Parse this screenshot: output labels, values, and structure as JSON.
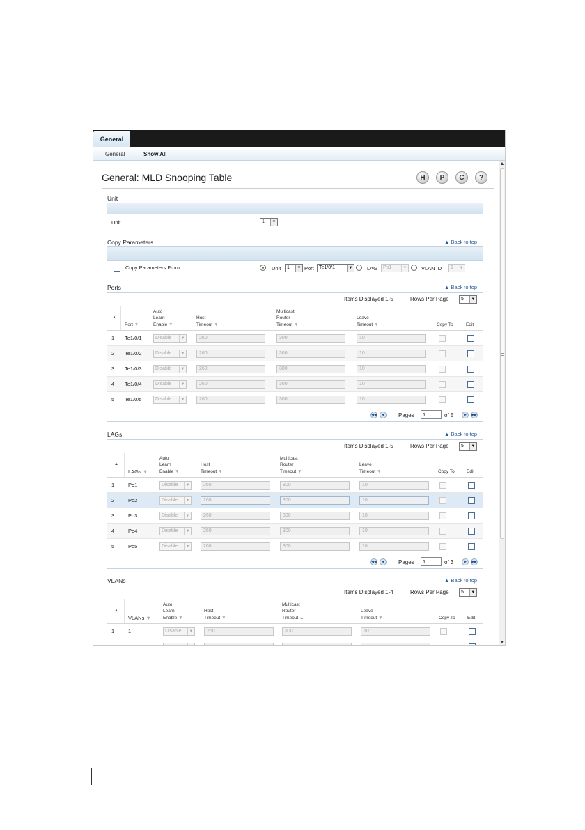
{
  "top_tab": "General",
  "subnav": {
    "general": "General",
    "show_all": "Show All"
  },
  "title": "General: MLD Snooping Table",
  "toolbar": {
    "save": "H",
    "print": "P",
    "refresh": "C",
    "help": "?"
  },
  "back_to_top": "Back to top",
  "unit_section": {
    "title": "Unit",
    "label": "Unit",
    "value": "1"
  },
  "copy_section": {
    "title": "Copy Parameters",
    "checkbox_label": "Copy Parameters From",
    "unit_label": "Unit",
    "unit_value": "1",
    "port_label": "Port",
    "port_value": "Te1/0/1",
    "lag_label": "LAG",
    "lag_value": "Po1",
    "vlan_label": "VLAN ID",
    "vlan_value": "1"
  },
  "common": {
    "rows_per_page_label": "Rows Per Page",
    "rows_per_page_value": "5",
    "pages_label": "Pages",
    "disable": "Disable",
    "h_auto": [
      "Auto",
      "Learn",
      "Enable"
    ],
    "h_host": [
      "Host",
      "Timeout"
    ],
    "h_mrouter": [
      "Multicast",
      "Router",
      "Timeout"
    ],
    "h_leave": [
      "Leave",
      "Timeout"
    ],
    "h_copy": "Copy To",
    "h_edit": "Edit"
  },
  "ports": {
    "title": "Ports",
    "items_displayed": "Items Displayed 1-5",
    "col_name": "Port",
    "rows": [
      {
        "idx": "1",
        "name": "Te1/0/1",
        "host": "260",
        "mrouter": "300",
        "leave": "10"
      },
      {
        "idx": "2",
        "name": "Te1/0/2",
        "host": "260",
        "mrouter": "300",
        "leave": "10"
      },
      {
        "idx": "3",
        "name": "Te1/0/3",
        "host": "260",
        "mrouter": "300",
        "leave": "10"
      },
      {
        "idx": "4",
        "name": "Te1/0/4",
        "host": "260",
        "mrouter": "300",
        "leave": "10"
      },
      {
        "idx": "5",
        "name": "Te1/0/5",
        "host": "260",
        "mrouter": "300",
        "leave": "10"
      }
    ],
    "page": "1",
    "of": "of 5"
  },
  "lags": {
    "title": "LAGs",
    "items_displayed": "Items Displayed 1-5",
    "col_name": "LAGs",
    "rows": [
      {
        "idx": "1",
        "name": "Po1",
        "host": "260",
        "mrouter": "300",
        "leave": "10"
      },
      {
        "idx": "2",
        "name": "Po2",
        "host": "260",
        "mrouter": "300",
        "leave": "10"
      },
      {
        "idx": "3",
        "name": "Po3",
        "host": "260",
        "mrouter": "300",
        "leave": "10"
      },
      {
        "idx": "4",
        "name": "Po4",
        "host": "260",
        "mrouter": "300",
        "leave": "10"
      },
      {
        "idx": "5",
        "name": "Po5",
        "host": "260",
        "mrouter": "300",
        "leave": "10"
      }
    ],
    "page": "1",
    "of": "of 3"
  },
  "vlans": {
    "title": "VLANs",
    "items_displayed": "Items Displayed 1-4",
    "col_name": "VLANs",
    "rows": [
      {
        "idx": "1",
        "name": "1",
        "host": "260",
        "mrouter": "300",
        "leave": "10"
      }
    ]
  }
}
